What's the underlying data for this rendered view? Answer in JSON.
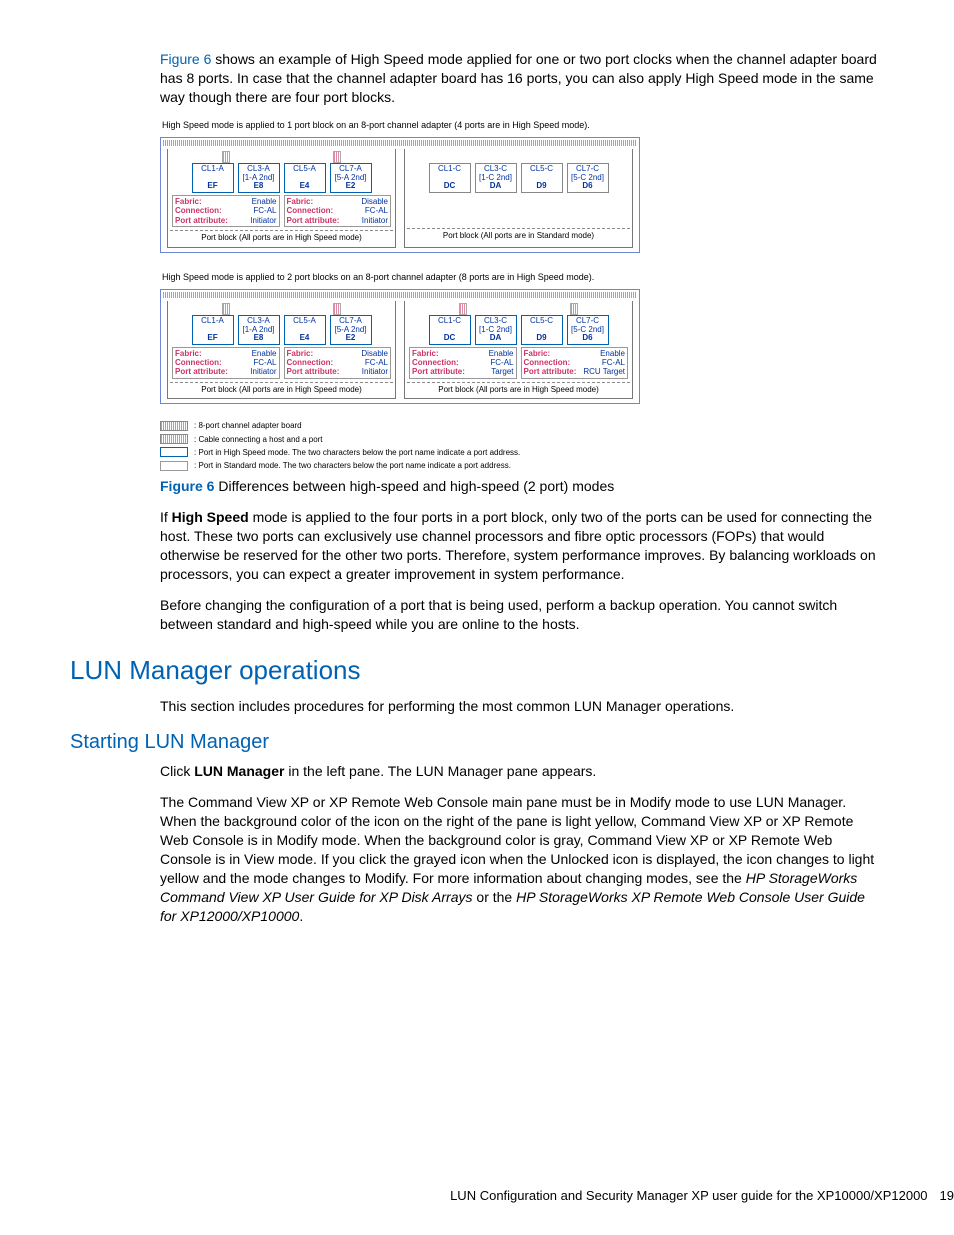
{
  "intro": {
    "figref": "Figure 6",
    "text1": " shows an example of High Speed mode applied for one or two port clocks when the channel adapter board has 8 ports. In case that the channel adapter board has 16 ports, you can also apply High Speed mode in the same way though there are four port blocks."
  },
  "figure": {
    "d1title": "High Speed mode is applied to 1 port block on an 8-port channel adapter (4 ports are in High Speed mode).",
    "d2title": "High Speed mode is applied to 2 port blocks on an 8-port channel adapter (8 ports are in High Speed mode).",
    "leftHalf": {
      "ports": [
        {
          "name": "CL1-A",
          "sub": "",
          "addr": "EF"
        },
        {
          "name": "CL3-A",
          "sub": "[1-A 2nd]",
          "addr": "E8"
        },
        {
          "name": "CL5-A",
          "sub": "",
          "addr": "E4"
        },
        {
          "name": "CL7-A",
          "sub": "[5-A 2nd]",
          "addr": "E2"
        }
      ],
      "attrs": [
        {
          "Fabric": "Enable",
          "Connection": "FC-AL",
          "Port attribute": "Initiator"
        },
        {
          "Fabric": "Disable",
          "Connection": "FC-AL",
          "Port attribute": "Initiator"
        }
      ],
      "note": "Port block (All ports are in High Speed mode)"
    },
    "rightHalf": {
      "ports": [
        {
          "name": "CL1-C",
          "sub": "",
          "addr": "DC"
        },
        {
          "name": "CL3-C",
          "sub": "[1-C 2nd]",
          "addr": "DA"
        },
        {
          "name": "CL5-C",
          "sub": "",
          "addr": "D9"
        },
        {
          "name": "CL7-C",
          "sub": "[5-C 2nd]",
          "addr": "D6"
        }
      ],
      "note": "Port block (All ports are in Standard mode)"
    },
    "rightHalf2": {
      "attrs": [
        {
          "Fabric": "Enable",
          "Connection": "FC-AL",
          "Port attribute": "Target"
        },
        {
          "Fabric": "Enable",
          "Connection": "FC-AL",
          "Port attribute": "RCU Target"
        }
      ],
      "note": "Port block (All ports are in High Speed mode)"
    },
    "legend": {
      "l1": ": 8-port channel adapter board",
      "l2": ": Cable connecting a host and a port",
      "l3": ": Port in High Speed mode. The two characters below the port name indicate a port address.",
      "l4": ": Port in Standard mode. The two characters below the port name indicate a port address."
    },
    "caption_label": "Figure 6",
    "caption_text": "Differences between high-speed and high-speed (2 port) modes"
  },
  "para2": {
    "pre": "If ",
    "bold": "High Speed",
    "post": " mode is applied to the four ports in a port block, only two of the ports can be used for connecting the host. These two ports can exclusively use channel processors and fibre optic processors (FOPs) that would otherwise be reserved for the other two ports. Therefore, system performance improves. By balancing workloads on processors, you can expect a greater improvement in system performance."
  },
  "para3": "Before changing the configuration of a port that is being used, perform a backup operation. You cannot switch between standard and high-speed while you are online to the hosts.",
  "h1": "LUN Manager operations",
  "para4": "This section includes procedures for performing the most common LUN Manager operations.",
  "h2": "Starting LUN Manager",
  "para5": {
    "pre": "Click ",
    "bold": "LUN Manager",
    "post": " in the left pane. The LUN Manager pane appears."
  },
  "para6": {
    "text": "The Command View XP or XP Remote Web Console main pane must be in Modify mode to use LUN Manager. When the background color of the icon on the right of the pane is light yellow, Command View XP or XP Remote Web Console is in Modify mode. When the background color is gray, Command View XP or XP Remote Web Console is in View mode. If you click the grayed icon when the Unlocked icon is displayed, the icon changes to light yellow and the mode changes to Modify. For more information about changing modes, see the ",
    "i1": "HP StorageWorks Command View XP User Guide for XP Disk Arrays",
    "mid": " or the ",
    "i2": "HP StorageWorks XP Remote Web Console User Guide for XP12000/XP10000",
    "end": "."
  },
  "footer": {
    "text": "LUN Configuration and Security Manager XP user guide for the XP10000/XP12000",
    "page": "19"
  }
}
